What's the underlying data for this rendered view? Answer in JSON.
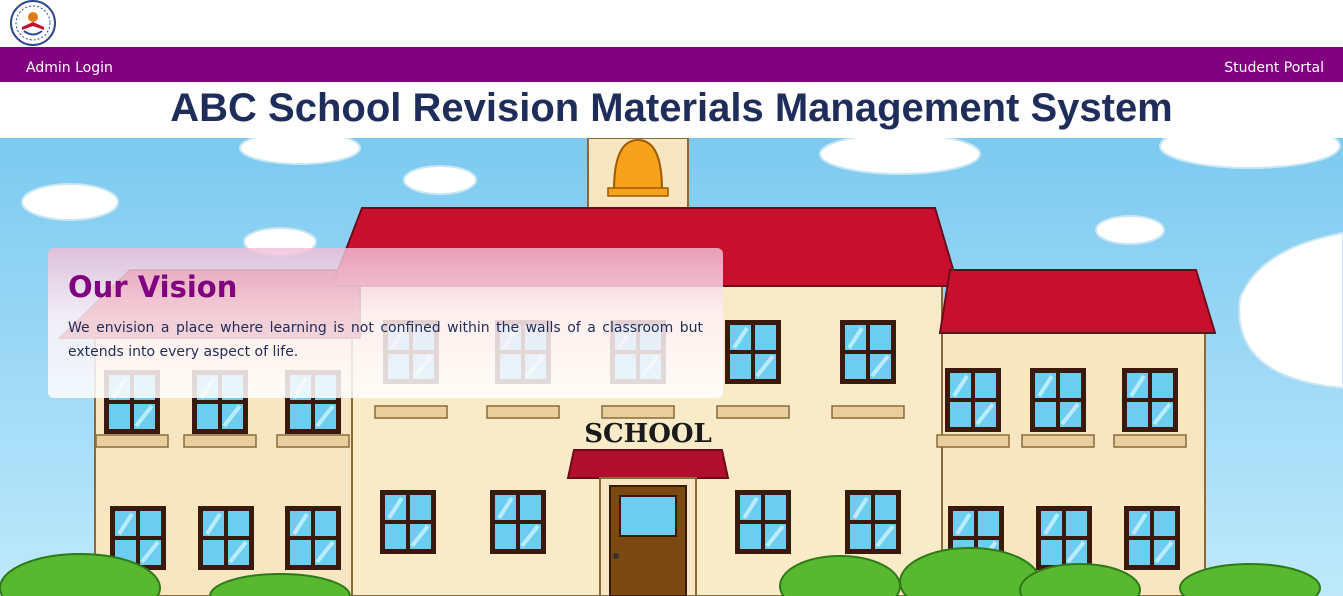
{
  "nav": {
    "admin_login": "Admin Login",
    "student_portal": "Student Portal"
  },
  "header": {
    "title": "ABC School Revision Materials Management System"
  },
  "hero": {
    "building_sign": "SCHOOL"
  },
  "vision": {
    "heading": "Our Vision",
    "text": "We envision a place where learning is not confined within the walls of a classroom but extends into every aspect of life."
  },
  "colors": {
    "nav_bg": "#800080",
    "title_color": "#1f2d5a",
    "vision_heading": "#800080",
    "sky": "#8fd3f5",
    "roof": "#c8102e",
    "wall": "#f8e6c0"
  },
  "icons": {
    "logo": "school-crest-logo"
  }
}
